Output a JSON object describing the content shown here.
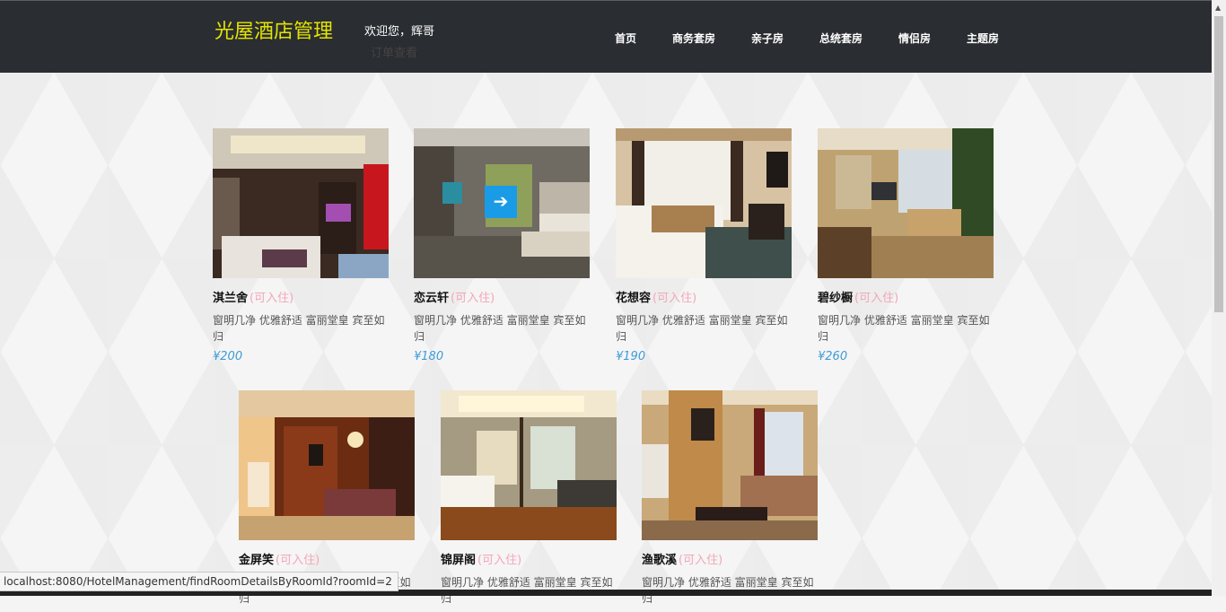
{
  "header": {
    "brand": "光屋酒店管理",
    "welcome": "欢迎您，辉哥",
    "orders_link": "订单查看",
    "nav": [
      "首页",
      "商务套房",
      "亲子房",
      "总统套房",
      "情侣房",
      "主题房"
    ]
  },
  "rooms": [
    {
      "name": "淇兰舍",
      "status": "(可入住)",
      "desc": "窗明几净 优雅舒适 富丽堂皇 宾至如归",
      "price": "¥200"
    },
    {
      "name": "恋云轩",
      "status": "(可入住)",
      "desc": "窗明几净 优雅舒适 富丽堂皇 宾至如归",
      "price": "¥180"
    },
    {
      "name": "花想容",
      "status": "(可入住)",
      "desc": "窗明几净 优雅舒适 富丽堂皇 宾至如归",
      "price": "¥190"
    },
    {
      "name": "碧纱橱",
      "status": "(可入住)",
      "desc": "窗明几净 优雅舒适 富丽堂皇 宾至如归",
      "price": "¥260"
    },
    {
      "name": "金屏笑",
      "status": "(可入住)",
      "desc": "窗明几净 优雅舒适 富丽堂皇 宾至如归",
      "price": ""
    },
    {
      "name": "锦屏阁",
      "status": "(可入住)",
      "desc": "窗明几净 优雅舒适 富丽堂皇 宾至如归",
      "price": ""
    },
    {
      "name": "渔歌溪",
      "status": "(可入住)",
      "desc": "窗明几净 优雅舒适 富丽堂皇 宾至如归",
      "price": ""
    }
  ],
  "hover_button_icon": "arrow-right-icon",
  "status_url": "localhost:8080/HotelManagement/findRoomDetailsByRoomId?roomId=2",
  "colors": {
    "topbar": "#2a2d31",
    "brand": "#e3e400",
    "status": "#f3a6b8",
    "price": "#3d9bd8",
    "hover_button": "#1a9be6"
  }
}
